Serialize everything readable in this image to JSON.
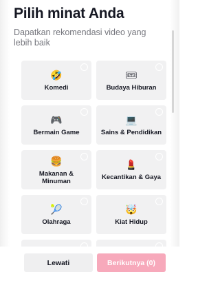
{
  "header": {
    "title": "Pilih minat Anda",
    "subtitle": "Dapatkan rekomendasi video yang lebih baik"
  },
  "interests": [
    {
      "label": "Komedi",
      "icon": "laughing-face-icon",
      "glyph": "🤣"
    },
    {
      "label": "Budaya Hiburan",
      "icon": "ticket-icon",
      "glyph": "🎟"
    },
    {
      "label": "Bermain Game",
      "icon": "gamepad-icon",
      "glyph": "🎮"
    },
    {
      "label": "Sains & Pendidikan",
      "icon": "laptop-icon",
      "glyph": "💻"
    },
    {
      "label": "Makanan & Minuman",
      "icon": "burger-icon",
      "glyph": "🍔"
    },
    {
      "label": "Kecantikan & Gaya",
      "icon": "lipstick-icon",
      "glyph": "💄"
    },
    {
      "label": "Olahraga",
      "icon": "tennis-ball-icon",
      "glyph": "🎾"
    },
    {
      "label": "Kiat Hidup",
      "icon": "exploding-head-icon",
      "glyph": "🤯"
    },
    {
      "label": "",
      "icon": "hammer-icon",
      "glyph": "🔨"
    },
    {
      "label": "",
      "icon": "pin-icon",
      "glyph": "📍"
    }
  ],
  "footer": {
    "skip_label": "Lewati",
    "next_label": "Berikutnya (0)"
  },
  "colors": {
    "card_bg": "#f1f1f2",
    "accent_disabled": "#f7a9bb",
    "text_primary": "#161823",
    "text_secondary": "#75767d"
  }
}
